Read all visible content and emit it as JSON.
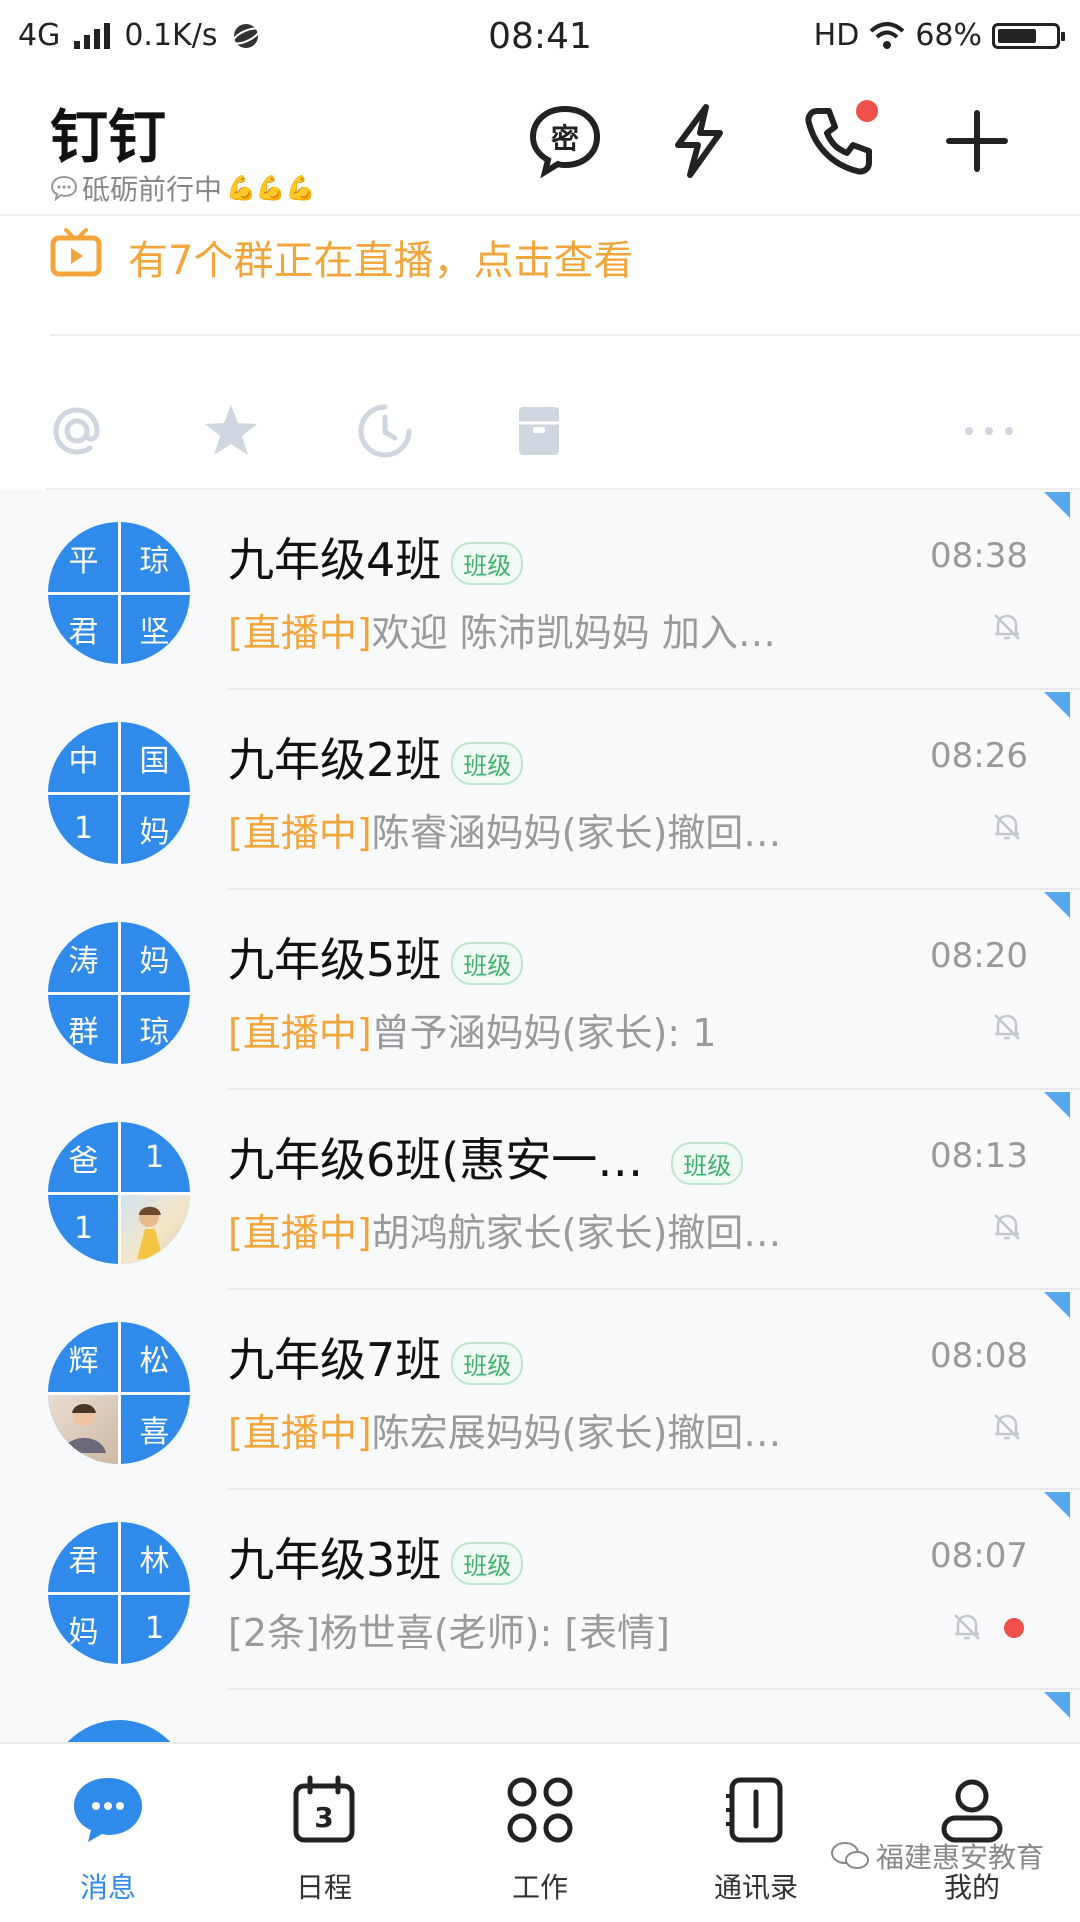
{
  "status_bar": {
    "network": "4G",
    "speed": "0.1K/s",
    "time": "08:41",
    "hd": "HD",
    "battery": "68%",
    "battery_level": 0.68
  },
  "header": {
    "title": "钉钉",
    "status": "砥砺前行中",
    "status_emoji": "💪💪💪",
    "icons": [
      "secret-chat-icon",
      "flash-icon",
      "phone-icon",
      "plus-icon"
    ],
    "phone_has_notification": true
  },
  "live_banner": {
    "text": "有7个群正在直播，点击查看",
    "color": "#f1a53a"
  },
  "quick_icons": [
    "at-icon",
    "star-icon",
    "clock-icon",
    "archive-icon",
    "more-icon"
  ],
  "conversations": [
    {
      "avatar_chars": [
        "平",
        "琼",
        "君",
        "坚"
      ],
      "title": "九年级4班",
      "badge": "班级",
      "tag": "[直播中]",
      "preview": "欢迎 陈沛凯妈妈 加入…",
      "time": "08:38",
      "muted": true
    },
    {
      "avatar_chars": [
        "中",
        "国",
        "1",
        "妈"
      ],
      "title": "九年级2班",
      "badge": "班级",
      "tag": "[直播中]",
      "preview": "陈睿涵妈妈(家长)撤回…",
      "time": "08:26",
      "muted": true
    },
    {
      "avatar_chars": [
        "涛",
        "妈",
        "群",
        "琼"
      ],
      "title": "九年级5班",
      "badge": "班级",
      "tag": "[直播中]",
      "preview": "曾予涵妈妈(家长): 1",
      "time": "08:20",
      "muted": true
    },
    {
      "avatar_chars": [
        "爸",
        "1",
        "1",
        ""
      ],
      "title": "九年级6班(惠安一…",
      "badge": "班级",
      "tag": "[直播中]",
      "preview": "胡鸿航家长(家长)撤回…",
      "time": "08:13",
      "muted": true
    },
    {
      "avatar_chars": [
        "辉",
        "松",
        "",
        "喜"
      ],
      "title": "九年级7班",
      "badge": "班级",
      "tag": "[直播中]",
      "preview": "陈宏展妈妈(家长)撤回…",
      "time": "08:08",
      "muted": true
    },
    {
      "avatar_chars": [
        "君",
        "林",
        "妈",
        "1"
      ],
      "title": "九年级3班",
      "badge": "班级",
      "tag": "",
      "preview": "[2条]杨世喜(老师): [表情]",
      "time": "08:07",
      "muted": true,
      "unread": true
    }
  ],
  "bottom_nav": [
    {
      "label": "消息",
      "icon": "chat-bubble-icon",
      "active": true
    },
    {
      "label": "日程",
      "icon": "calendar-icon",
      "active": false,
      "calendar_day": "3"
    },
    {
      "label": "工作",
      "icon": "apps-grid-icon",
      "active": false
    },
    {
      "label": "通讯录",
      "icon": "contacts-book-icon",
      "active": false
    },
    {
      "label": "我的",
      "icon": "person-icon",
      "active": false
    }
  ],
  "watermark": "福建惠安教育",
  "colors": {
    "accent_blue": "#2f8ae9",
    "live_orange": "#f1a53a",
    "badge_green": "#3bb16b",
    "notify_red": "#f0504a"
  }
}
